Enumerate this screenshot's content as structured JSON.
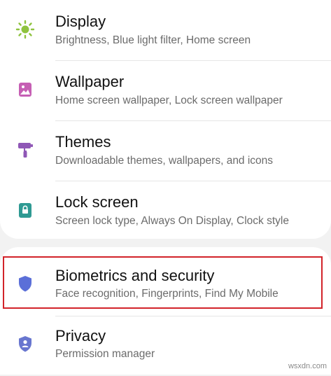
{
  "settings_items": [
    {
      "title": "Display",
      "subtitle": "Brightness, Blue light filter, Home screen",
      "icon": "sun-icon",
      "color": "#8fc33f"
    },
    {
      "title": "Wallpaper",
      "subtitle": "Home screen wallpaper, Lock screen wallpaper",
      "icon": "image-icon",
      "color": "#c65fb4"
    },
    {
      "title": "Themes",
      "subtitle": "Downloadable themes, wallpapers, and icons",
      "icon": "paintbrush-icon",
      "color": "#8f57b6"
    },
    {
      "title": "Lock screen",
      "subtitle": "Screen lock type, Always On Display, Clock style",
      "icon": "lock-icon",
      "color": "#2f9a93"
    },
    {
      "title": "Biometrics and security",
      "subtitle": "Face recognition, Fingerprints, Find My Mobile",
      "icon": "shield-icon",
      "color": "#5b6fd8"
    },
    {
      "title": "Privacy",
      "subtitle": "Permission manager",
      "icon": "privacy-shield-icon",
      "color": "#6876cf"
    }
  ],
  "highlight_color": "#d2232a",
  "watermark": "wsxdn.com"
}
